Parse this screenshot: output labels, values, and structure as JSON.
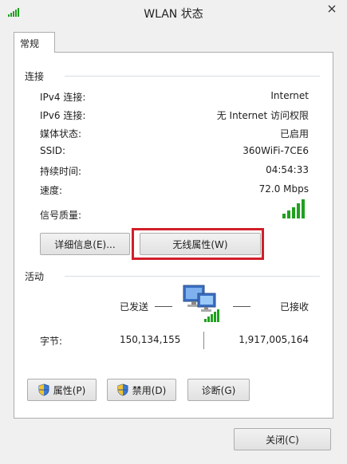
{
  "window": {
    "title": "WLAN 状态"
  },
  "tab": {
    "label": "常规"
  },
  "connection": {
    "section_title": "连接",
    "rows": [
      {
        "label": "IPv4 连接:",
        "value": "Internet"
      },
      {
        "label": "IPv6 连接:",
        "value": "无 Internet 访问权限"
      },
      {
        "label": "媒体状态:",
        "value": "已启用"
      },
      {
        "label": "SSID:",
        "value": "360WiFi-7CE6"
      },
      {
        "label": "持续时间:",
        "value": "04:54:33"
      },
      {
        "label": "速度:",
        "value": "72.0 Mbps"
      }
    ],
    "signal_label": "信号质量:",
    "signal_bars": 5,
    "details_button": "详细信息(E)...",
    "wireless_props_button": "无线属性(W)"
  },
  "activity": {
    "section_title": "活动",
    "sent_label": "已发送",
    "received_label": "已接收",
    "bytes_label": "字节:",
    "bytes_sent": "150,134,155",
    "bytes_received": "1,917,005,164"
  },
  "buttons": {
    "properties": "属性(P)",
    "disable": "禁用(D)",
    "diagnose": "诊断(G)",
    "close": "关闭(C)"
  },
  "colors": {
    "highlight": "#d11f2a",
    "signal": "#20a020"
  }
}
